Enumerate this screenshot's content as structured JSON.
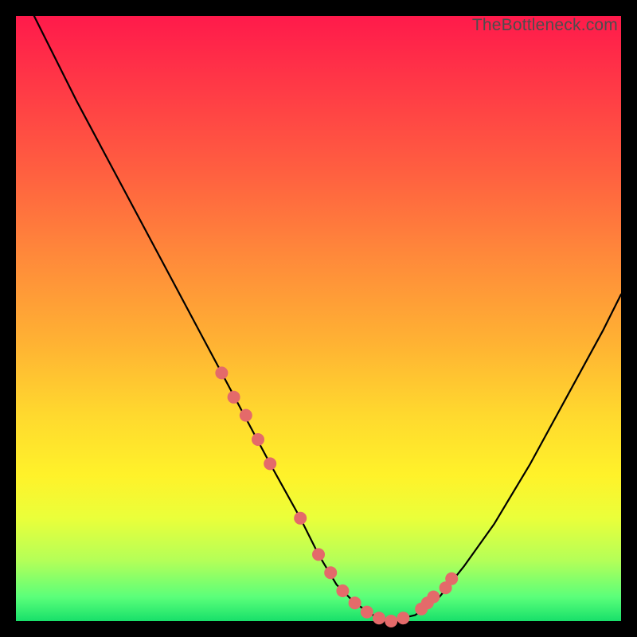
{
  "watermark": "TheBottleneck.com",
  "chart_data": {
    "type": "line",
    "title": "",
    "xlabel": "",
    "ylabel": "",
    "xlim": [
      0,
      100
    ],
    "ylim": [
      0,
      100
    ],
    "legend": "none",
    "grid": false,
    "series": [
      {
        "name": "curve",
        "x": [
          3,
          10,
          18,
          26,
          34,
          42,
          47,
          50,
          53,
          56,
          59,
          62,
          66,
          70,
          74,
          79,
          85,
          91,
          97,
          100
        ],
        "y": [
          100,
          86,
          71,
          56,
          41,
          26,
          17,
          11,
          6,
          3,
          1,
          0,
          1,
          4,
          9,
          16,
          26,
          37,
          48,
          54
        ]
      }
    ],
    "markers": [
      {
        "name": "highlight-dots",
        "x": [
          34,
          36,
          38,
          40,
          42,
          47,
          50,
          52,
          54,
          56,
          58,
          60,
          62,
          64,
          67,
          68,
          69,
          71,
          72
        ],
        "y": [
          41,
          37,
          34,
          30,
          26,
          17,
          11,
          8,
          5,
          3,
          1.5,
          0.5,
          0,
          0.5,
          2,
          3,
          4,
          5.5,
          7
        ]
      }
    ],
    "background_gradient": {
      "stops": [
        {
          "pos": 0,
          "color": "#ff1a4b"
        },
        {
          "pos": 40,
          "color": "#ff8a3a"
        },
        {
          "pos": 70,
          "color": "#ffe92e"
        },
        {
          "pos": 100,
          "color": "#18e06a"
        }
      ]
    }
  }
}
